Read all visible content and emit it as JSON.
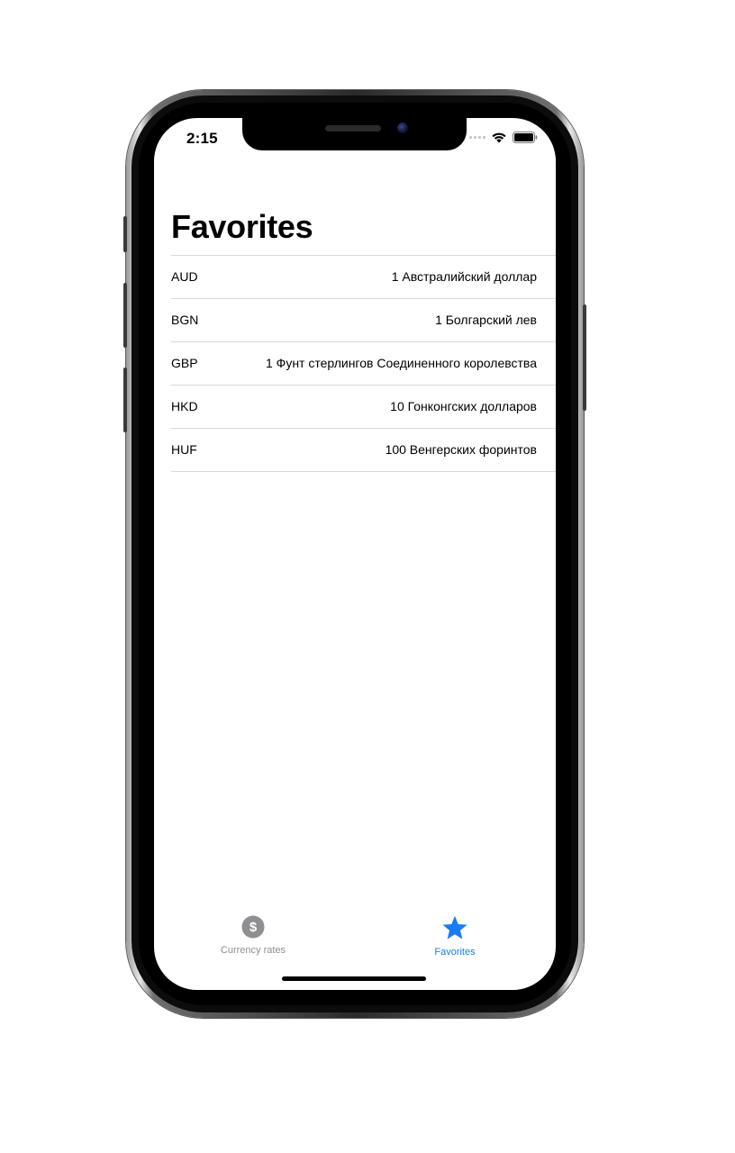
{
  "status_bar": {
    "time": "2:15"
  },
  "page": {
    "title": "Favorites"
  },
  "favorites": [
    {
      "code": "AUD",
      "name": "1 Австралийский доллар"
    },
    {
      "code": "BGN",
      "name": "1 Болгарский лев"
    },
    {
      "code": "GBP",
      "name": "1 Фунт стерлингов Соединенного королевства"
    },
    {
      "code": "HKD",
      "name": "10 Гонконгских долларов"
    },
    {
      "code": "HUF",
      "name": "100 Венгерских форинтов"
    }
  ],
  "tab_bar": {
    "tabs": [
      {
        "label": "Currency rates",
        "icon": "dollar-circle-icon",
        "selected": false
      },
      {
        "label": "Favorites",
        "icon": "star-icon",
        "selected": true
      }
    ]
  },
  "colors": {
    "accent": "#1a7cf5",
    "inactive_tab": "#8e8e93",
    "separator": "#d8d8d8"
  }
}
